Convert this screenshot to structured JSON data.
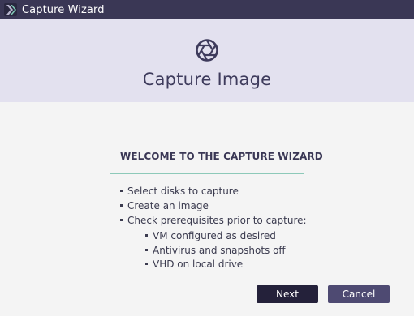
{
  "window": {
    "title": "Capture Wizard",
    "app_icon": "wizard-app-icon"
  },
  "banner": {
    "icon": "camera-aperture-icon",
    "title": "Capture Image"
  },
  "content": {
    "heading": "WELCOME TO THE CAPTURE WIZARD",
    "steps": [
      "Select disks to capture",
      "Create an image",
      "Check prerequisites prior to capture:"
    ],
    "prerequisites": [
      "VM configured as desired",
      "Antivirus and snapshots off",
      "VHD on local drive"
    ]
  },
  "buttons": {
    "next_label": "Next",
    "cancel_label": "Cancel"
  },
  "colors": {
    "titlebar": "#3a3755",
    "banner": "#e3e1ef",
    "divider": "#8dc9b9",
    "next_button": "#24213a",
    "cancel_button": "#4e4a72"
  }
}
